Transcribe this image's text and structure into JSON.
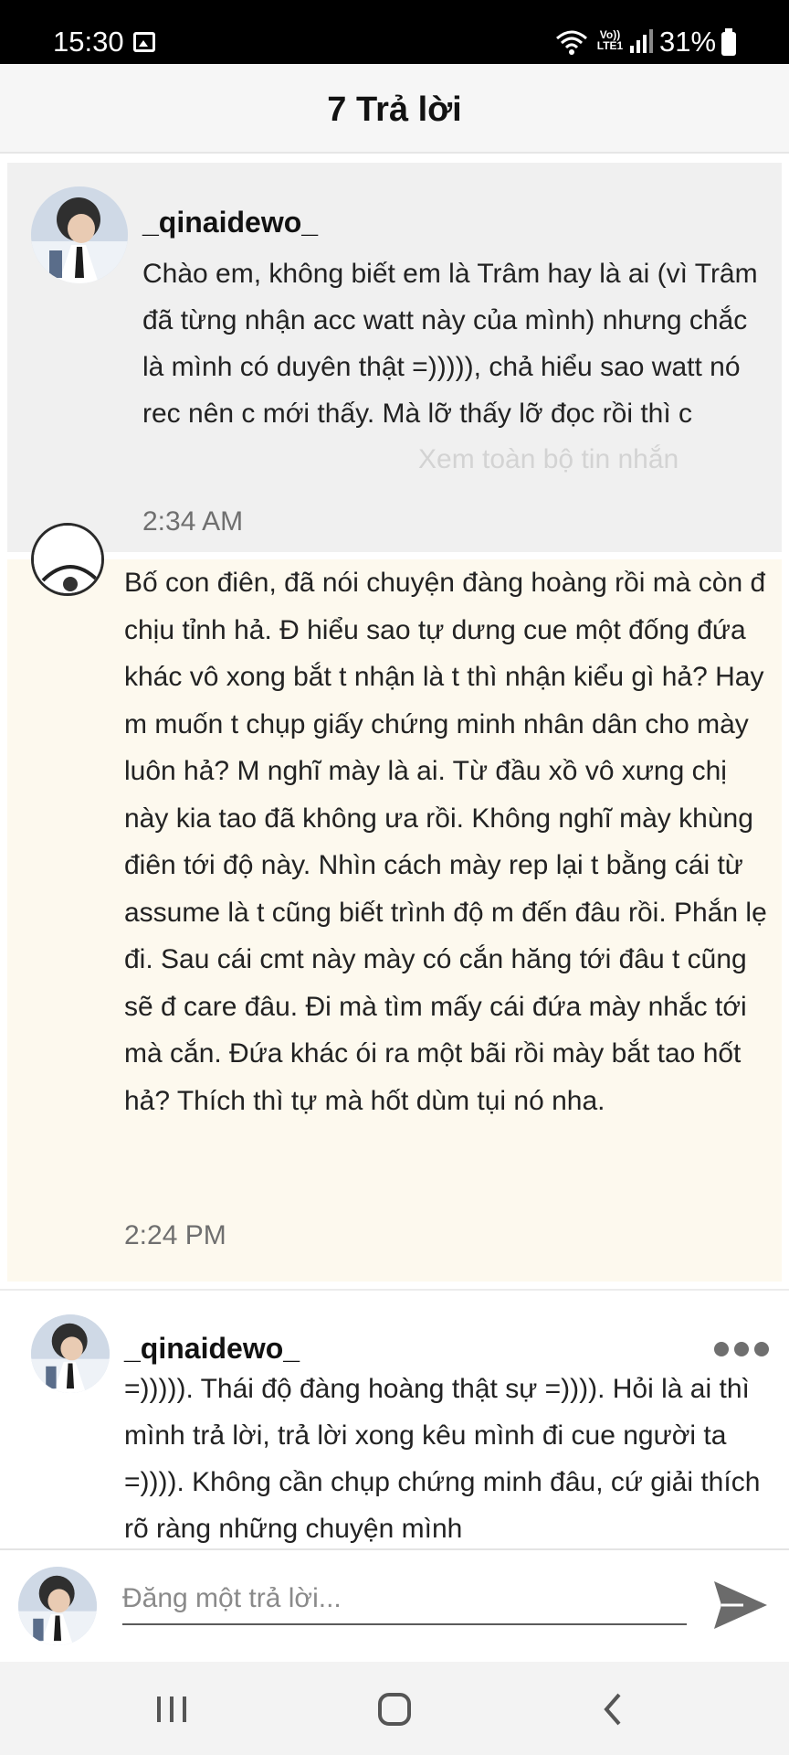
{
  "status_bar": {
    "time": "15:30",
    "network_label": "Vo)) LTE1",
    "battery": "31%",
    "icons": [
      "gallery-icon",
      "wifi-icon",
      "volte-icon",
      "signal-icon",
      "battery-icon"
    ]
  },
  "header": {
    "title": "7 Trả lời"
  },
  "parent_comment": {
    "username": "_qinaidewo_",
    "text": "Chào em, không biết em là Trâm hay là ai (vì Trâm đã từng nhận acc watt này của mình) nhưng chắc là mình có duyên thật =))))), chả hiểu sao watt nó rec nên c mới thấy. Mà lỡ thấy lỡ đọc rồi thì c",
    "see_more": "Xem toàn bộ tin nhắn",
    "timestamp": "2:34 AM"
  },
  "highlighted_reply": {
    "text": "Bố con điên, đã nói chuyện đàng hoàng rồi mà còn đ chịu tỉnh hả. Đ hiểu sao tự dưng cue một đống đứa khác vô xong bắt t nhận là t thì nhận kiểu gì hả? Hay m muốn t chụp giấy chứng minh nhân dân cho mày luôn hả? M nghĩ mày là ai. Từ đầu xồ vô xưng chị này kia tao đã không ưa rồi. Không nghĩ mày khùng điên tới độ này. Nhìn cách mày rep lại t bằng cái từ assume là t cũng biết trình độ m đến đâu rồi. Phắn lẹ đi. Sau cái cmt này mày có cắn hăng tới đâu t cũng sẽ đ care đâu. Đi mà tìm mấy cái đứa mày nhắc tới mà cắn. Đứa khác ói ra một bãi rồi mày bắt tao hốt hả? Thích thì tự mà hốt dùm tụi nó nha.",
    "timestamp": "2:24 PM"
  },
  "comment3": {
    "username": "_qinaidewo_",
    "text": "=))))). Thái độ đàng hoàng thật sự =)))). Hỏi là ai thì mình trả lời, trả lời xong kêu mình đi cue người ta =)))). Không cần chụp chứng minh đâu, cứ giải thích rõ ràng những chuyện mình"
  },
  "composer": {
    "placeholder": "Đăng một trả lời..."
  },
  "colors": {
    "header_bg": "#f6f6f6",
    "parent_bg": "#f0f0f0",
    "highlight_bg": "#fdf9ee",
    "timestamp": "#6f6f6f",
    "send_icon": "#6b6b6b"
  }
}
